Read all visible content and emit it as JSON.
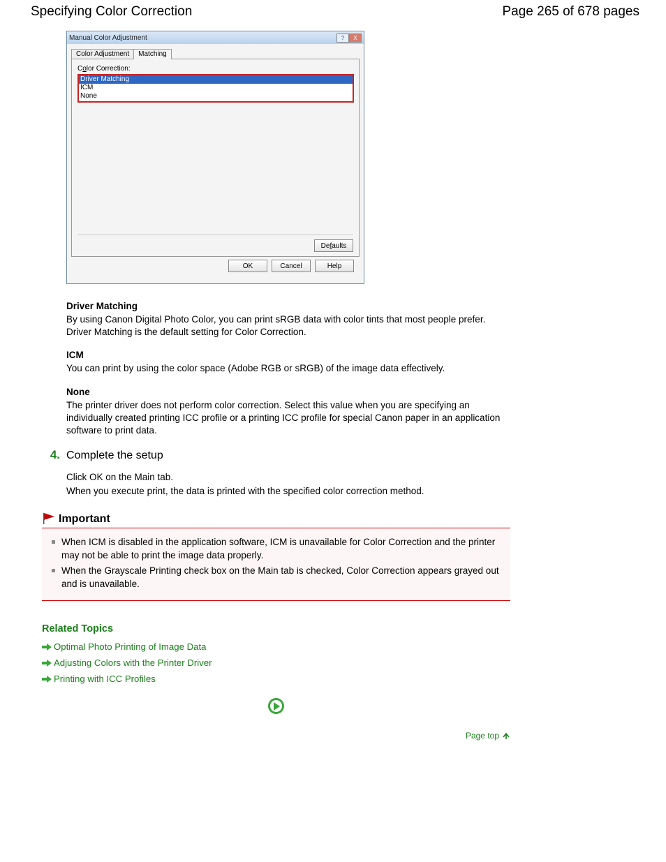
{
  "header": {
    "title": "Specifying Color Correction",
    "page_info": "Page 265 of 678 pages"
  },
  "dialog": {
    "title": "Manual Color Adjustment",
    "help_icon": "?",
    "close_icon": "X",
    "tabs": {
      "tab1": "Color Adjustment",
      "tab2": "Matching"
    },
    "field_label_pre": "C",
    "field_label_u": "o",
    "field_label_post": "lor Correction:",
    "options": {
      "opt1": "Driver Matching",
      "opt2": "ICM",
      "opt3": "None"
    },
    "defaults_pre": "De",
    "defaults_u": "f",
    "defaults_post": "aults",
    "ok": "OK",
    "cancel": "Cancel",
    "help": "Help"
  },
  "defs": {
    "dm_title": "Driver Matching",
    "dm_body": "By using Canon Digital Photo Color, you can print sRGB data with color tints that most people prefer. Driver Matching is the default setting for Color Correction.",
    "icm_title": "ICM",
    "icm_body": "You can print by using the color space (Adobe RGB or sRGB) of the image data effectively.",
    "none_title": "None",
    "none_body": "The printer driver does not perform color correction. Select this value when you are specifying an individually created printing ICC profile or a printing ICC profile for special Canon paper in an application software to print data."
  },
  "step": {
    "num": "4.",
    "title": "Complete the setup",
    "line1": "Click OK on the Main tab.",
    "line2": "When you execute print, the data is printed with the specified color correction method."
  },
  "important": {
    "label": "Important",
    "item1": "When ICM is disabled in the application software, ICM is unavailable for Color Correction and the printer may not be able to print the image data properly.",
    "item2": "When the Grayscale Printing check box on the Main tab is checked, Color Correction appears grayed out and is unavailable."
  },
  "related": {
    "title": "Related Topics",
    "link1": "Optimal Photo Printing of Image Data",
    "link2": "Adjusting Colors with the Printer Driver",
    "link3": "Printing with ICC Profiles"
  },
  "pagetop": "Page top"
}
